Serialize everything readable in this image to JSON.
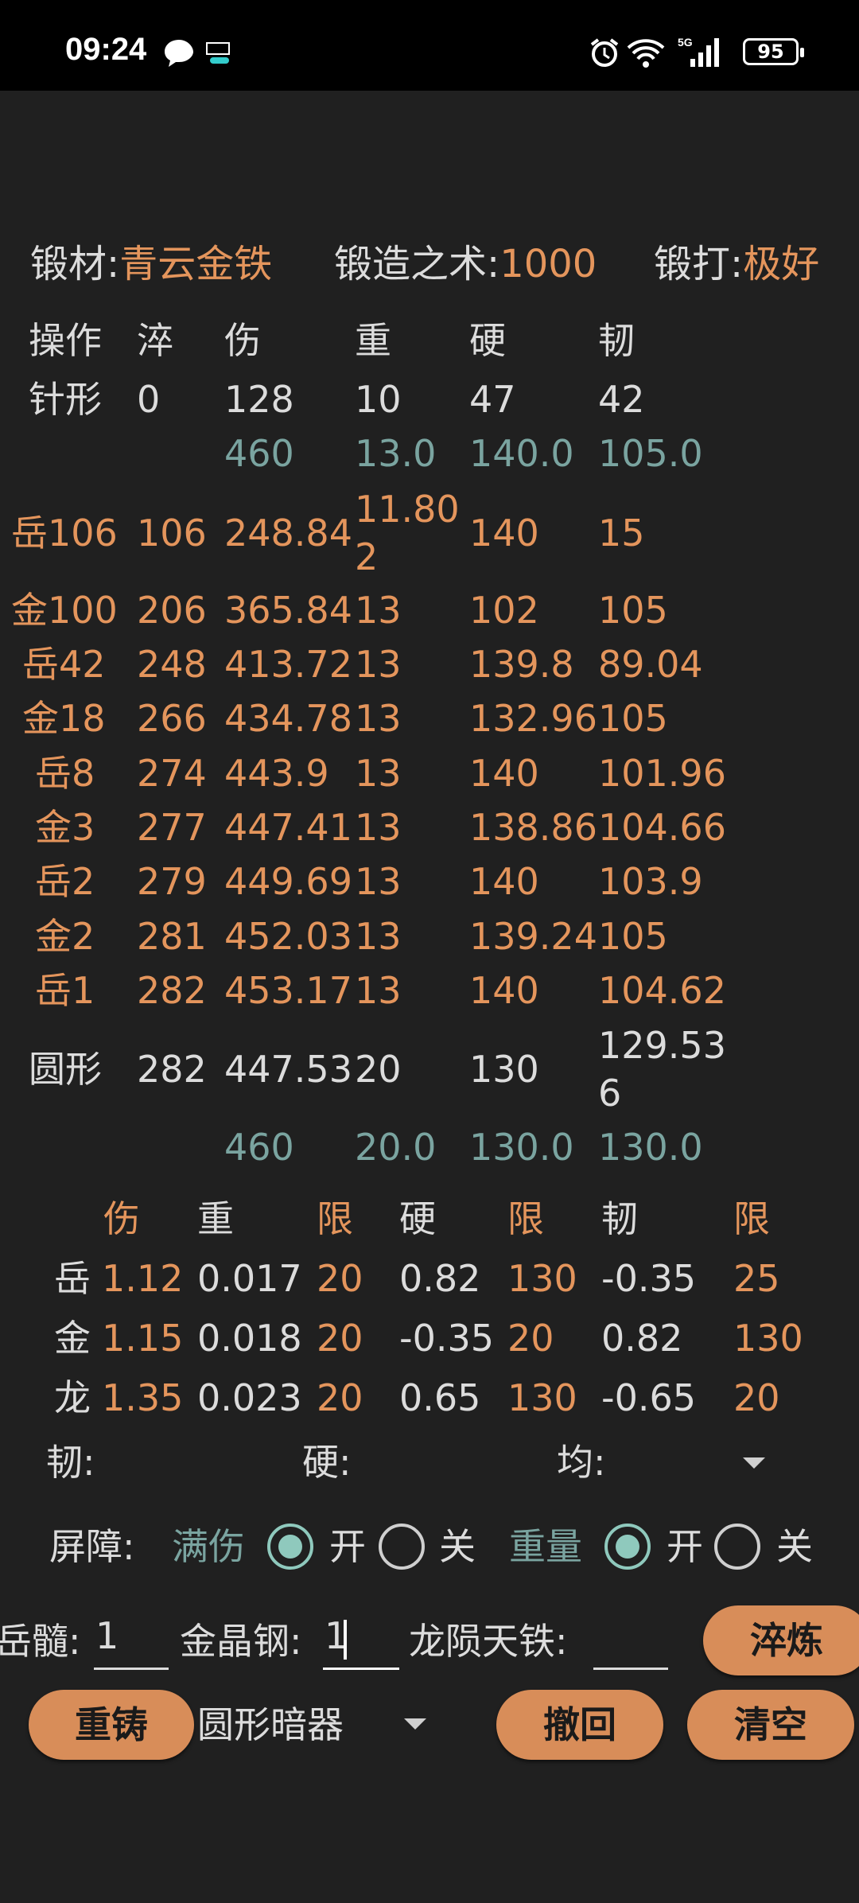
{
  "status": {
    "time": "09:24",
    "battery": "95",
    "network": "5G"
  },
  "header": {
    "material_label": "锻材:",
    "material_value": "青云金铁",
    "skill_label": "锻造之术:",
    "skill_value": "1000",
    "forge_label": "锻打:",
    "forge_value": "极好"
  },
  "table": {
    "headers": [
      "操作",
      "淬",
      "伤",
      "重",
      "硬",
      "韧"
    ],
    "rows": [
      {
        "op": "针形",
        "cui": "0",
        "shang": "128",
        "zhong": "10",
        "ying": "47",
        "ren": "42"
      },
      {
        "op": "",
        "cui": "",
        "shang": "460",
        "zhong": "13.0",
        "ying": "140.0",
        "ren": "105.0"
      },
      {
        "op": "岳106",
        "cui": "106",
        "shang": "248.84",
        "zhong": "11.802",
        "ying": "140",
        "ren": "15"
      },
      {
        "op": "金100",
        "cui": "206",
        "shang": "365.84",
        "zhong": "13",
        "ying": "102",
        "ren": "105"
      },
      {
        "op": "岳42",
        "cui": "248",
        "shang": "413.72",
        "zhong": "13",
        "ying": "139.8",
        "ren": "89.04"
      },
      {
        "op": "金18",
        "cui": "266",
        "shang": "434.78",
        "zhong": "13",
        "ying": "132.96",
        "ren": "105"
      },
      {
        "op": "岳8",
        "cui": "274",
        "shang": "443.9",
        "zhong": "13",
        "ying": "140",
        "ren": "101.96"
      },
      {
        "op": "金3",
        "cui": "277",
        "shang": "447.41",
        "zhong": "13",
        "ying": "138.86",
        "ren": "104.66"
      },
      {
        "op": "岳2",
        "cui": "279",
        "shang": "449.69",
        "zhong": "13",
        "ying": "140",
        "ren": "103.9"
      },
      {
        "op": "金2",
        "cui": "281",
        "shang": "452.03",
        "zhong": "13",
        "ying": "139.24",
        "ren": "105"
      },
      {
        "op": "岳1",
        "cui": "282",
        "shang": "453.17",
        "zhong": "13",
        "ying": "140",
        "ren": "104.62"
      },
      {
        "op": "圆形",
        "cui": "282",
        "shang": "447.53",
        "zhong": "20",
        "ying": "130",
        "ren": "129.536"
      },
      {
        "op": "",
        "cui": "",
        "shang": "460",
        "zhong": "20.0",
        "ying": "130.0",
        "ren": "130.0"
      }
    ]
  },
  "coef": {
    "headers": [
      "伤",
      "重",
      "限",
      "硬",
      "限",
      "韧",
      "限"
    ],
    "rows": [
      {
        "name": "岳",
        "values": [
          "1.12",
          "0.017",
          "20",
          "0.82",
          "130",
          "-0.35",
          "25"
        ]
      },
      {
        "name": "金",
        "values": [
          "1.15",
          "0.018",
          "20",
          "-0.35",
          "20",
          "0.82",
          "130"
        ]
      },
      {
        "name": "龙",
        "values": [
          "1.35",
          "0.023",
          "20",
          "0.65",
          "130",
          "-0.65",
          "20"
        ]
      }
    ]
  },
  "filters": {
    "ren": "韧:",
    "ying": "硬:",
    "jun": "均:"
  },
  "barrier": {
    "label": "屏障:",
    "opt1": "满伤",
    "opt2": "重量",
    "on": "开",
    "off": "关"
  },
  "inputs": {
    "yue_label": "岳髓:",
    "yue_value": "1",
    "jin_label": "金晶钢:",
    "jin_value": "1",
    "long_label": "龙陨天铁:",
    "long_value": ""
  },
  "buttons": {
    "refine": "淬炼",
    "recast": "重铸",
    "undo": "撤回",
    "clear": "清空"
  },
  "weapon_select": "圆形暗器",
  "colors": {
    "accent": "#d88d59",
    "orange_text": "#e4955c",
    "teal_text": "#7aa4a0",
    "radio": "#8fc9bd"
  }
}
